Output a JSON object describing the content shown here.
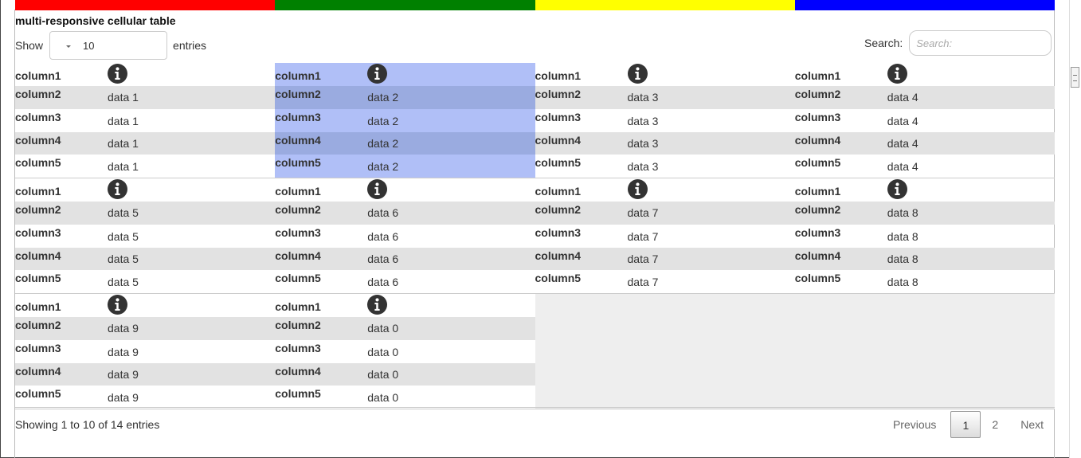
{
  "title": "multi-responsive cellular table",
  "stripes": [
    "#ff0000",
    "#008000",
    "#ffff00",
    "#0000ff"
  ],
  "length": {
    "show_label": "Show",
    "value": "10",
    "entries_label": "entries"
  },
  "search": {
    "label": "Search:",
    "placeholder": "Search:"
  },
  "row_labels": [
    "column1",
    "column2",
    "column3",
    "column4",
    "column5"
  ],
  "records": [
    {
      "data": "data 1",
      "selected": false
    },
    {
      "data": "data 2",
      "selected": true
    },
    {
      "data": "data 3",
      "selected": false
    },
    {
      "data": "data 4",
      "selected": false
    },
    {
      "data": "data 5",
      "selected": false
    },
    {
      "data": "data 6",
      "selected": false
    },
    {
      "data": "data 7",
      "selected": false
    },
    {
      "data": "data 8",
      "selected": false
    },
    {
      "data": "data 9",
      "selected": false
    },
    {
      "data": "data 0",
      "selected": false
    }
  ],
  "footer": {
    "info": "Showing 1 to 10 of 14 entries",
    "previous": "Previous",
    "pages": [
      "1",
      "2"
    ],
    "active_page": "1",
    "next": "Next"
  },
  "icons": {
    "row_header": "info-icon"
  }
}
